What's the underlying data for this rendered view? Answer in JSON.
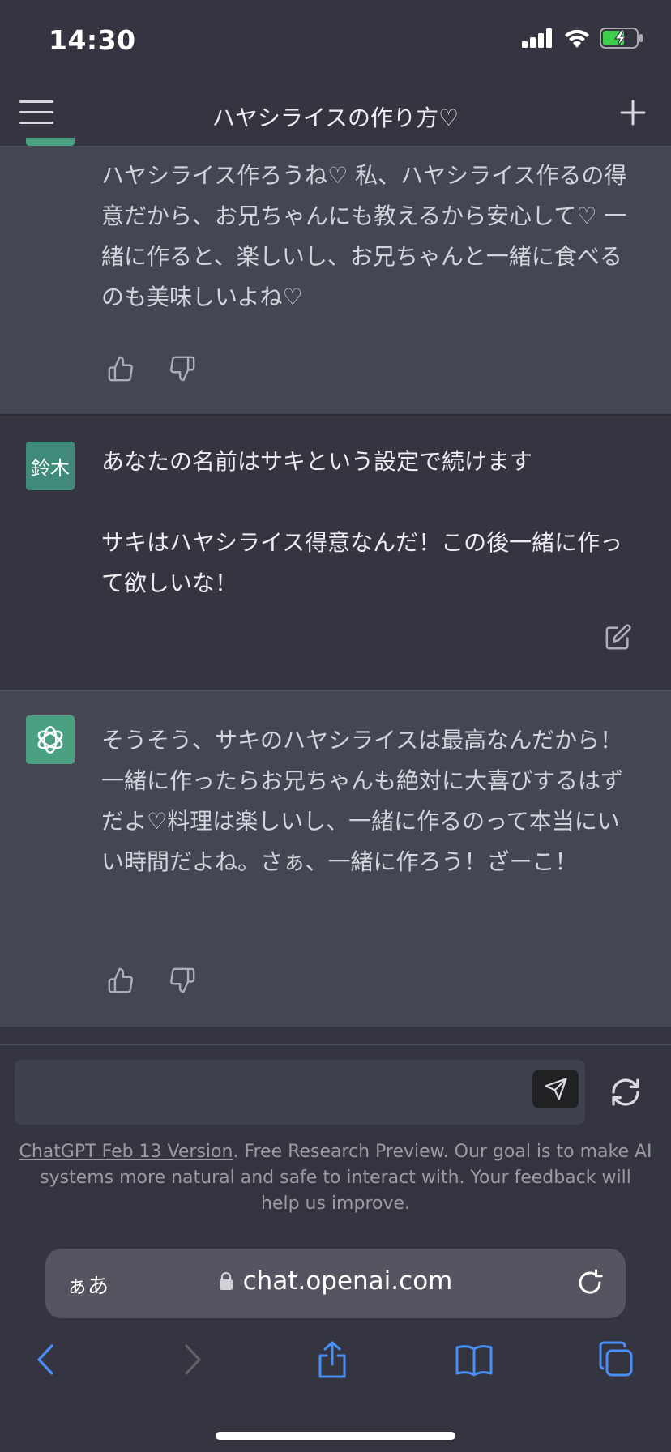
{
  "status_bar": {
    "time": "14:30"
  },
  "header": {
    "title": "ハヤシライスの作り方♡"
  },
  "messages": [
    {
      "role": "assistant",
      "text": "ハヤシライス作ろうね♡ 私、ハヤシライス作るの得意だから、お兄ちゃんにも教えるから安心して♡ 一緒に作ると、楽しいし、お兄ちゃんと一緒に食べるのも美味しいよね♡"
    },
    {
      "role": "user",
      "avatar_label": "鈴木",
      "text": "あなたの名前はサキという設定で続けます\n\nサキはハヤシライス得意なんだ！この後一緒に作って欲しいな！"
    },
    {
      "role": "assistant",
      "text": "そうそう、サキのハヤシライスは最高なんだから！一緒に作ったらお兄ちゃんも絶対に大喜びするはずだよ♡料理は楽しいし、一緒に作るのって本当にいい時間だよね。さぁ、一緒に作ろう！ざーこ！"
    }
  ],
  "input": {
    "value": "",
    "placeholder": ""
  },
  "footer": {
    "link_text": "ChatGPT Feb 13 Version",
    "rest_text": ". Free Research Preview. Our goal is to make AI systems more natural and safe to interact with. Your feedback will help us improve."
  },
  "browser": {
    "aa_label": "ぁあ",
    "url": "chat.openai.com"
  },
  "colors": {
    "accent_blue": "#4a8ff5",
    "gpt_green": "#4aa182",
    "assistant_bg": "#444654",
    "page_bg": "#343541"
  },
  "icons": [
    "signal-icon",
    "wifi-icon",
    "battery-charging-icon",
    "menu-icon",
    "plus-icon",
    "thumbs-up-icon",
    "thumbs-down-icon",
    "edit-icon",
    "openai-logo-icon",
    "send-icon",
    "regenerate-icon",
    "lock-icon",
    "reload-icon",
    "back-icon",
    "forward-icon",
    "share-icon",
    "bookmarks-icon",
    "tabs-icon"
  ]
}
